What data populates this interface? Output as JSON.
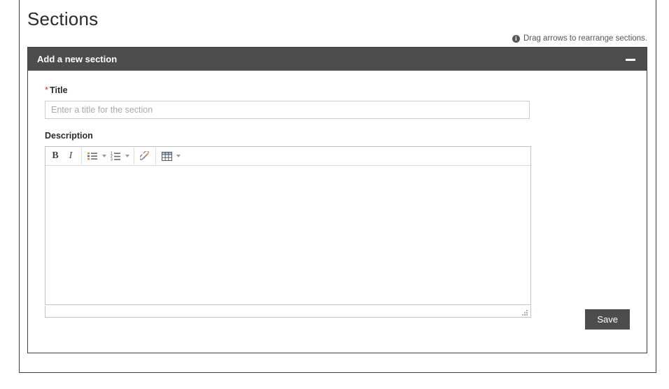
{
  "page": {
    "title": "Sections"
  },
  "hint": {
    "icon": "info-icon",
    "text": "Drag arrows to rearrange sections."
  },
  "panel": {
    "header_title": "Add a new section",
    "minimize_icon": "minimize-icon",
    "fields": {
      "title": {
        "label": "Title",
        "required_marker": "*",
        "placeholder": "Enter a title for the section",
        "value": ""
      },
      "description": {
        "label": "Description",
        "value": ""
      }
    },
    "editor_toolbar": [
      {
        "name": "bold-button",
        "glyph": "B",
        "label": "Bold",
        "has_caret": false
      },
      {
        "name": "italic-button",
        "glyph": "I",
        "label": "Italic",
        "has_caret": false
      },
      {
        "name": "bullet-list-button",
        "glyph": "bullet-list-icon",
        "label": "Bulleted list",
        "has_caret": true
      },
      {
        "name": "numbered-list-button",
        "glyph": "numbered-list-icon",
        "label": "Numbered list",
        "has_caret": true
      },
      {
        "name": "link-button",
        "glyph": "link-icon",
        "label": "Insert link",
        "has_caret": false
      },
      {
        "name": "table-button",
        "glyph": "table-icon",
        "label": "Insert table",
        "has_caret": true
      }
    ],
    "resize_grip": "resize-grip-icon",
    "save_label": "Save"
  },
  "colors": {
    "header_background": "#4d4d4d",
    "save_background": "#4d4d4d",
    "required_star": "#c0392b",
    "border": "#3f3f3f",
    "input_border": "#cccccc",
    "placeholder_text": "#a9a9a9",
    "page_background": "#ffffff"
  }
}
